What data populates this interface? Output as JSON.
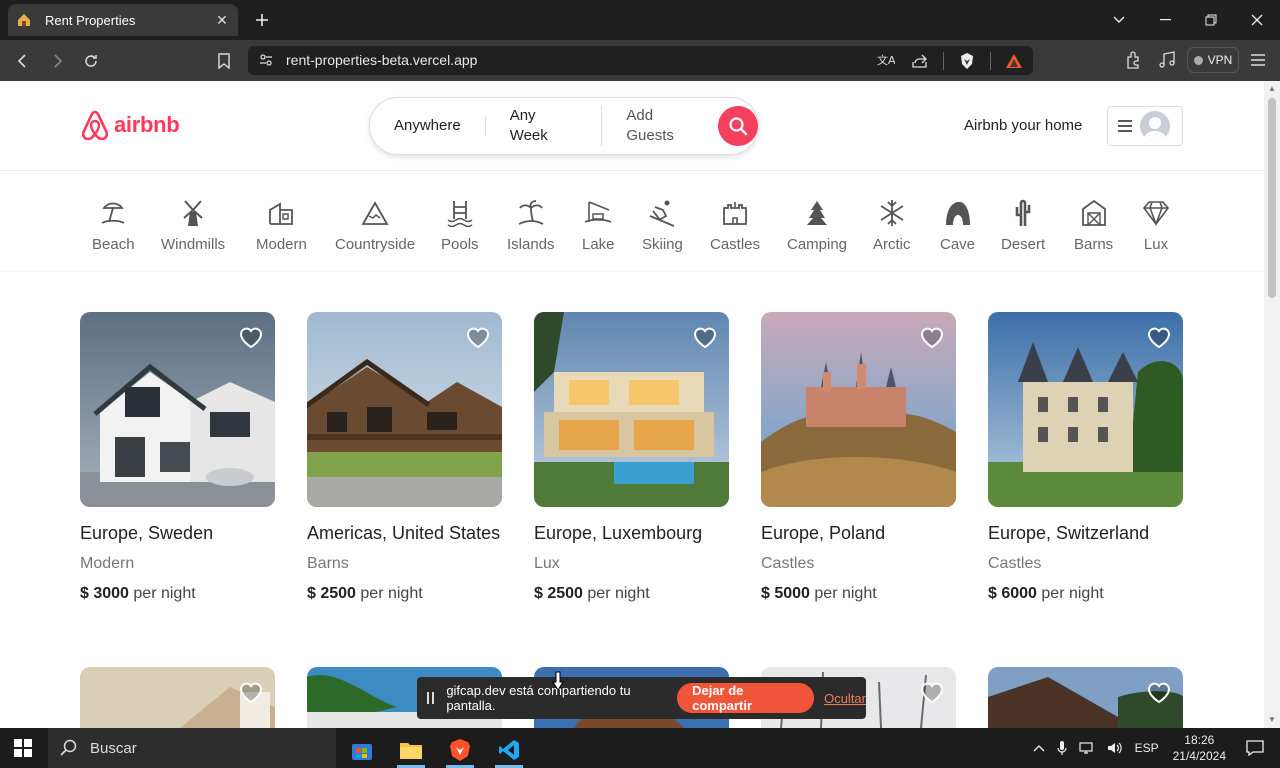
{
  "browser": {
    "tab_title": "Rent Properties",
    "url": "rent-properties-beta.vercel.app",
    "vpn_label": "VPN"
  },
  "header": {
    "logo_text": "airbnb",
    "search": {
      "where": "Anywhere",
      "when": "Any Week",
      "who": "Add Guests"
    },
    "host_link": "Airbnb your home"
  },
  "categories": [
    {
      "label": "Beach",
      "icon": "beach-icon"
    },
    {
      "label": "Windmills",
      "icon": "windmill-icon"
    },
    {
      "label": "Modern",
      "icon": "modern-building-icon"
    },
    {
      "label": "Countryside",
      "icon": "mountain-icon"
    },
    {
      "label": "Pools",
      "icon": "pool-icon"
    },
    {
      "label": "Islands",
      "icon": "island-icon"
    },
    {
      "label": "Lake",
      "icon": "lake-icon"
    },
    {
      "label": "Skiing",
      "icon": "skiing-icon"
    },
    {
      "label": "Castles",
      "icon": "castle-icon"
    },
    {
      "label": "Camping",
      "icon": "camping-icon"
    },
    {
      "label": "Arctic",
      "icon": "snowflake-icon"
    },
    {
      "label": "Cave",
      "icon": "cave-icon"
    },
    {
      "label": "Desert",
      "icon": "cactus-icon"
    },
    {
      "label": "Barns",
      "icon": "barn-icon"
    },
    {
      "label": "Lux",
      "icon": "diamond-icon"
    }
  ],
  "listings": [
    {
      "location": "Europe, Sweden",
      "category": "Modern",
      "price": "$ 3000",
      "per": "per night"
    },
    {
      "location": "Americas, United States",
      "category": "Barns",
      "price": "$ 2500",
      "per": "per night"
    },
    {
      "location": "Europe, Luxembourg",
      "category": "Lux",
      "price": "$ 2500",
      "per": "per night"
    },
    {
      "location": "Europe, Poland",
      "category": "Castles",
      "price": "$ 5000",
      "per": "per night"
    },
    {
      "location": "Europe, Switzerland",
      "category": "Castles",
      "price": "$ 6000",
      "per": "per night"
    }
  ],
  "share_bar": {
    "message": "gifcap.dev está compartiendo tu pantalla.",
    "stop_label": "Dejar de compartir",
    "hide_label": "Ocultar"
  },
  "taskbar": {
    "search_placeholder": "Buscar",
    "language": "ESP",
    "time": "18:26",
    "date": "21/4/2024"
  },
  "colors": {
    "brand": "#ff385c",
    "search_button": "#f43f5e",
    "share_stop": "#f0553a"
  }
}
